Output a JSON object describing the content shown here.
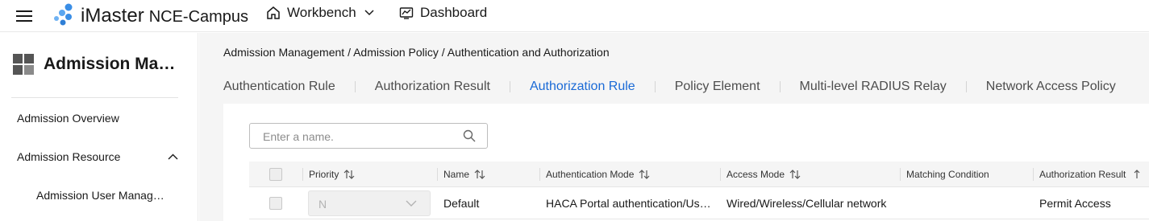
{
  "header": {
    "brand_name": "iMaster",
    "brand_product": "NCE-Campus",
    "nav": [
      {
        "label": "Workbench",
        "icon": "home-icon"
      },
      {
        "label": "Dashboard",
        "icon": "dashboard-icon"
      }
    ]
  },
  "sidebar": {
    "title": "Admission Management",
    "items": [
      {
        "label": "Admission Overview"
      },
      {
        "label": "Admission Resource",
        "expanded": true
      },
      {
        "label": "Admission User Management"
      }
    ]
  },
  "breadcrumb": "Admission Management / Admission Policy / Authentication and Authorization",
  "tabs": [
    {
      "label": "Authentication Rule"
    },
    {
      "label": "Authorization Result"
    },
    {
      "label": "Authorization Rule",
      "active": true
    },
    {
      "label": "Policy Element"
    },
    {
      "label": "Multi-level RADIUS Relay"
    },
    {
      "label": "Network Access Policy"
    }
  ],
  "search": {
    "placeholder": "Enter a name."
  },
  "table": {
    "columns": [
      {
        "label": "Priority",
        "sortable": true
      },
      {
        "label": "Name",
        "sortable": true
      },
      {
        "label": "Authentication Mode",
        "sortable": true
      },
      {
        "label": "Access Mode",
        "sortable": true
      },
      {
        "label": "Matching Condition",
        "sortable": false
      },
      {
        "label": "Authorization Result",
        "sortable": true
      }
    ],
    "rows": [
      {
        "priority": "N",
        "name": "Default",
        "auth_mode": "HACA Portal authentication/User…",
        "access_mode": "Wired/Wireless/Cellular network",
        "matching_condition": "",
        "auth_result": "Permit Access"
      }
    ]
  },
  "colors": {
    "accent": "#1a6ad6",
    "logo": "#3a8ee6"
  }
}
